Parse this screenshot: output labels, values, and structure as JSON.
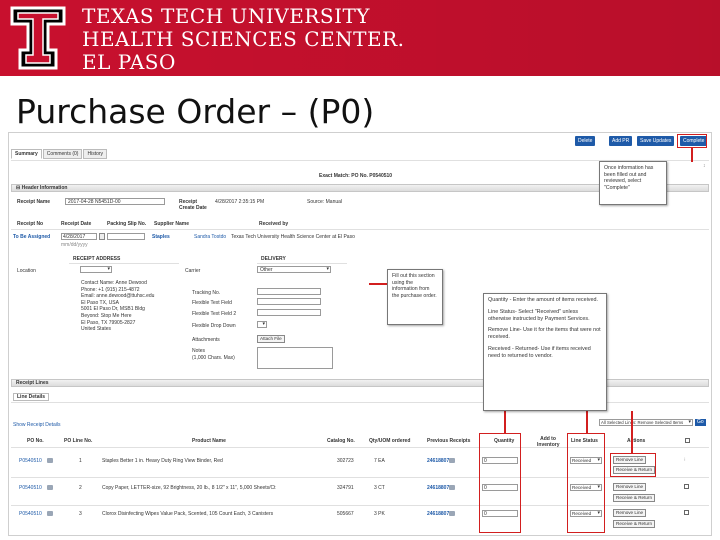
{
  "banner": {
    "line1": "TEXAS TECH UNIVERSITY",
    "line2": "HEALTH SCIENCES CENTER.",
    "line3": "EL PASO"
  },
  "slide_title": "Purchase Order – (P0)",
  "toolbar": {
    "delete": "Delete",
    "add_pr": "Add PR",
    "send_updates": "Save Updates",
    "complete": "Complete"
  },
  "tabs": [
    "Summary",
    "Comments (0)",
    "History"
  ],
  "exact_match": "Exact Match: PO No. P0540510",
  "header_info": {
    "title": "Header Information",
    "receipt_name_label": "Receipt Name",
    "receipt_name_value": "2017-04-28 N5451D-00",
    "receipt_create_label": "Receipt Create Date",
    "receipt_create_value": "4/28/2017 2:35:15 PM",
    "source_label": "Source: Manual",
    "col_receipt_no": "Receipt No",
    "col_receipt_date": "Receipt Date",
    "col_packing_slip": "Packing Slip No.",
    "col_supplier": "Supplier Name",
    "col_received_by": "Received by",
    "to_be_assigned": "To Be Assigned",
    "receipt_date_value": "4/28/2017",
    "date_format": "mm/dd/yyyy",
    "supplier_value": "Staples",
    "received_by_user": "Sandra Tostdo",
    "received_by_org": "Texas Tech University Health Science Center at El Paso"
  },
  "address": {
    "receipt_address_title": "RECEIPT ADDRESS",
    "delivery_title": "DELIVERY",
    "location_label": "Location",
    "carrier_label": "Carrier",
    "carrier_value": "Other",
    "contact_lines": [
      "Contact Name: Anne Dewood",
      "Phone: +1 (915) 215-4872",
      "Email: anne.dewood@ttuhsc.edu",
      "El Paso TX, USA",
      "5001 El Paso Dr, MSB1 Bldg",
      "Beyond: Stop Me Here",
      "El Paso, TX 79905-2827",
      "United States"
    ],
    "tracking_label": "Tracking No.",
    "flex1_label": "Flexible Text Field",
    "flex2_label": "Flexible Text Field 2",
    "flex_drop_label": "Flexible Drop Down",
    "attachments_label": "Attachments",
    "attach_file_link": "Attach File",
    "notes_label": "Notes",
    "notes_max": "(1,000 Chars. Max)"
  },
  "receipt_lines": {
    "title": "Receipt Lines",
    "line_details_tab": "Line Details",
    "show_details": "Show Receipt Details",
    "bulk_action": "All Selected Lines: Remove Selected Items",
    "go": "Go",
    "columns": [
      "PO No.",
      "PO Line No.",
      "Product Name",
      "Catalog No.",
      "Qty/UOM ordered",
      "Previous Receipts",
      "Quantity",
      "Add to Inventory",
      "Line Status",
      "Actions"
    ],
    "rows": [
      {
        "po": "P0540510",
        "line": "1",
        "product": "Staples Better 1 in. Heavy Duty Ring View Binder, Red",
        "catalog": "302723",
        "qty_uom": "7 EA",
        "prev": "24618807",
        "quantity": "0",
        "status": "Received",
        "action1": "Remove Line",
        "action2": "Receive & Return"
      },
      {
        "po": "P0540510",
        "line": "2",
        "product": "Copy Paper, LETTER-size, 92 Brightness, 20 lb., 8 1/2\" x 11\", 5,000 Sheets/Ct",
        "catalog": "324791",
        "qty_uom": "3 CT",
        "prev": "24618807",
        "quantity": "0",
        "status": "Received",
        "action1": "Remove Line",
        "action2": "Receive & Return"
      },
      {
        "po": "P0540510",
        "line": "3",
        "product": "Clorox Disinfecting Wipes Value Pack, Scented, 105 Count Each, 3 Canisters",
        "catalog": "505667",
        "qty_uom": "3 PK",
        "prev": "24618807",
        "quantity": "0",
        "status": "Received",
        "action1": "Remove Line",
        "action2": "Receive & Return"
      }
    ]
  },
  "callouts": {
    "complete": "Once information has been filled out and reviewed, select \"Complete\"",
    "fill_section": "Fill out this section using the information from the purchase order.",
    "quantity_p1": "Quantity - Enter the amount of items received.",
    "quantity_p2": "Line Status- Select \"Received\" unless otherwise instructed by Payment Services.",
    "quantity_p3": "Remove Line- Use it for the items that were not received.",
    "quantity_p4": "Received - Returned- Use if items received need to returned to vendor."
  },
  "colors": {
    "banner_red": "#c8102e",
    "link_blue": "#1e5aa8",
    "callout_red": "#d21f1f"
  }
}
